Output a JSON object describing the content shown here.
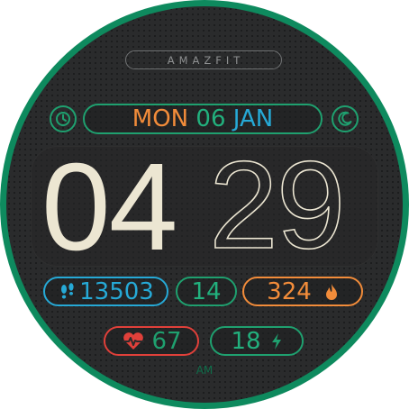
{
  "brand": "AMAZFIT",
  "date": {
    "weekday": "MON",
    "day": "06",
    "month": "JAN"
  },
  "time": {
    "hour": "04",
    "minute": "29",
    "period": "AM"
  },
  "stats": {
    "steps": "13503",
    "stat_two": "14",
    "calories": "324",
    "heart_rate": "67",
    "battery": "18"
  },
  "icons": {
    "alarm": "clock-icon",
    "night": "moon-icon",
    "steps": "footprints-icon",
    "calories": "flame-icon",
    "heart": "heart-pulse-icon",
    "battery": "lightning-icon"
  },
  "colors": {
    "bezel": "#0e8a5e",
    "green": "#1fa06f",
    "orange": "#f28c3a",
    "blue": "#26a9d6",
    "red": "#e0403a",
    "cream": "#ece6d2"
  }
}
